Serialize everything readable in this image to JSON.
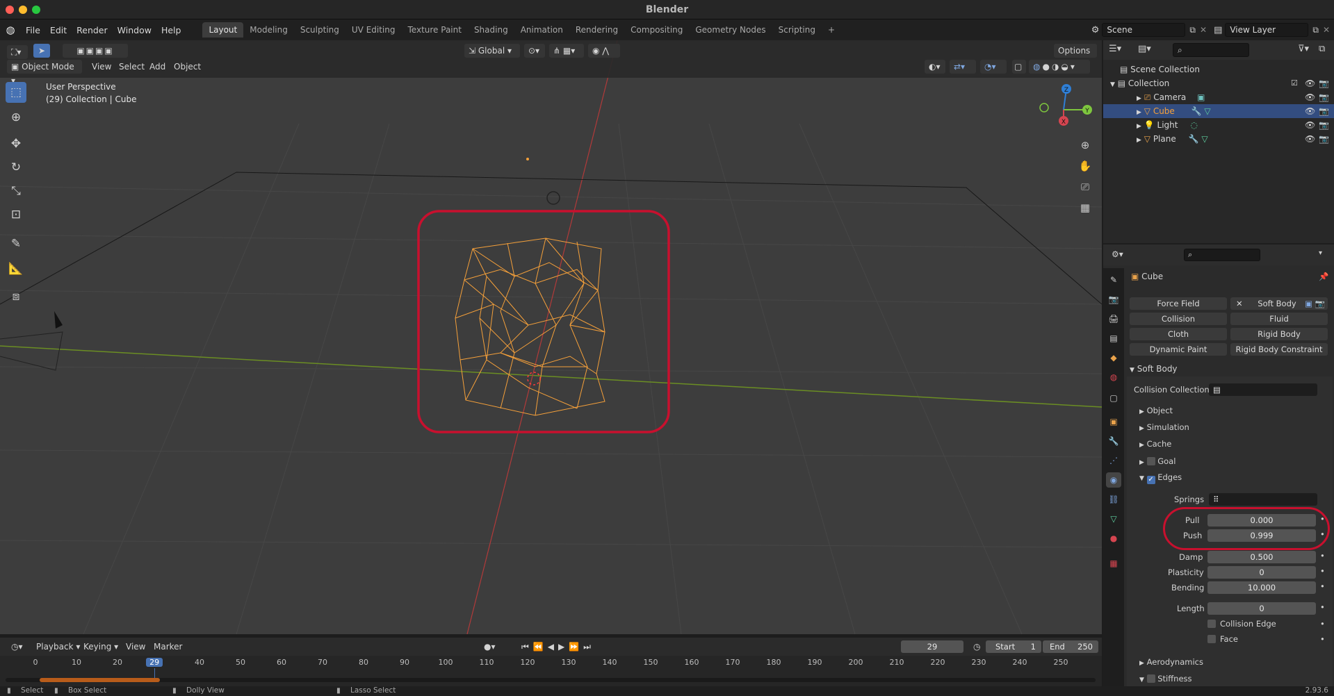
{
  "window": {
    "title": "Blender",
    "version": "2.93.6"
  },
  "menu": [
    "File",
    "Edit",
    "Render",
    "Window",
    "Help"
  ],
  "workspaces": [
    "Layout",
    "Modeling",
    "Sculpting",
    "UV Editing",
    "Texture Paint",
    "Shading",
    "Animation",
    "Rendering",
    "Compositing",
    "Geometry Nodes",
    "Scripting"
  ],
  "active_workspace": "Layout",
  "scene": "Scene",
  "view_layer": "View Layer",
  "viewport": {
    "transform_orientation": "Global",
    "options": "Options",
    "mode": "Object Mode",
    "menus": [
      "View",
      "Select",
      "Add",
      "Object"
    ],
    "perspective": "User Perspective",
    "collection_info": "(29) Collection | Cube"
  },
  "axes": {
    "z": "Z",
    "y": "Y",
    "x": "X"
  },
  "outliner": {
    "root": "Scene Collection",
    "collection": "Collection",
    "items": [
      {
        "name": "Camera"
      },
      {
        "name": "Cube",
        "selected": true
      },
      {
        "name": "Light"
      },
      {
        "name": "Plane"
      }
    ]
  },
  "properties": {
    "object_name": "Cube",
    "physics_buttons": [
      [
        "Force Field",
        "Soft Body"
      ],
      [
        "Collision",
        "Fluid"
      ],
      [
        "Cloth",
        "Rigid Body"
      ],
      [
        "Dynamic Paint",
        "Rigid Body Constraint"
      ]
    ],
    "remove_mark": "✕",
    "panel": "Soft Body",
    "collision_collection_label": "Collision Collection",
    "subpanels": [
      "Object",
      "Simulation",
      "Cache",
      "Goal",
      "Edges"
    ],
    "edges": {
      "springs_label": "Springs",
      "fields": [
        {
          "label": "Pull",
          "value": "0.000"
        },
        {
          "label": "Push",
          "value": "0.999"
        },
        {
          "label": "Damp",
          "value": "0.500"
        },
        {
          "label": "Plasticity",
          "value": "0"
        },
        {
          "label": "Bending",
          "value": "10.000"
        },
        {
          "label": "Length",
          "value": "0"
        }
      ],
      "collision_edge": "Collision Edge",
      "face": "Face"
    },
    "more": [
      "Aerodynamics",
      "Stiffness"
    ]
  },
  "timeline": {
    "menus": [
      "Playback",
      "Keying",
      "View",
      "Marker"
    ],
    "current_frame": "29",
    "start_label": "Start",
    "start": "1",
    "end_label": "End",
    "end": "250",
    "ticks": [
      "0",
      "10",
      "20",
      "29",
      "40",
      "50",
      "60",
      "70",
      "80",
      "90",
      "100",
      "110",
      "120",
      "130",
      "140",
      "150",
      "160",
      "170",
      "180",
      "190",
      "200",
      "210",
      "220",
      "230",
      "240",
      "250"
    ]
  },
  "status": {
    "select": "Select",
    "box_select": "Box Select",
    "dolly": "Dolly View",
    "lasso": "Lasso Select"
  },
  "colors": {
    "accent": "#4772b3",
    "selection": "#f5a03a",
    "highlight_ring": "#c8102e"
  }
}
